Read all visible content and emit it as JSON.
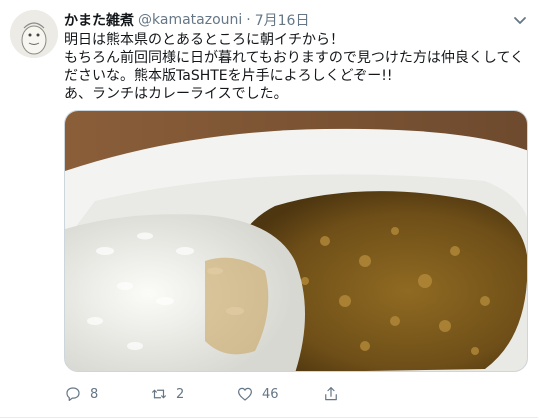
{
  "tweet": {
    "author": {
      "display_name": "かまた雑煮",
      "handle": "@kamatazouni",
      "separator": "·",
      "date": "7月16日"
    },
    "text_lines": [
      "明日は熊本県のとあるところに朝イチから！",
      "もちろん前回同様に日が暮れてもおりますので見つけた方は仲良くしてくださいな。熊本版TaSHTEを片手によろしくどぞー!!",
      "あ、ランチはカレーライスでした。"
    ],
    "actions": {
      "reply_icon": "reply-icon",
      "reply_count": "8",
      "retweet_icon": "retweet-icon",
      "retweet_count": "2",
      "like_icon": "heart-icon",
      "like_count": "46",
      "share_icon": "share-icon"
    },
    "menu_icon": "chevron-down-icon",
    "colors": {
      "text": "#14171a",
      "secondary": "#657786",
      "border": "#e6ecf0"
    }
  }
}
